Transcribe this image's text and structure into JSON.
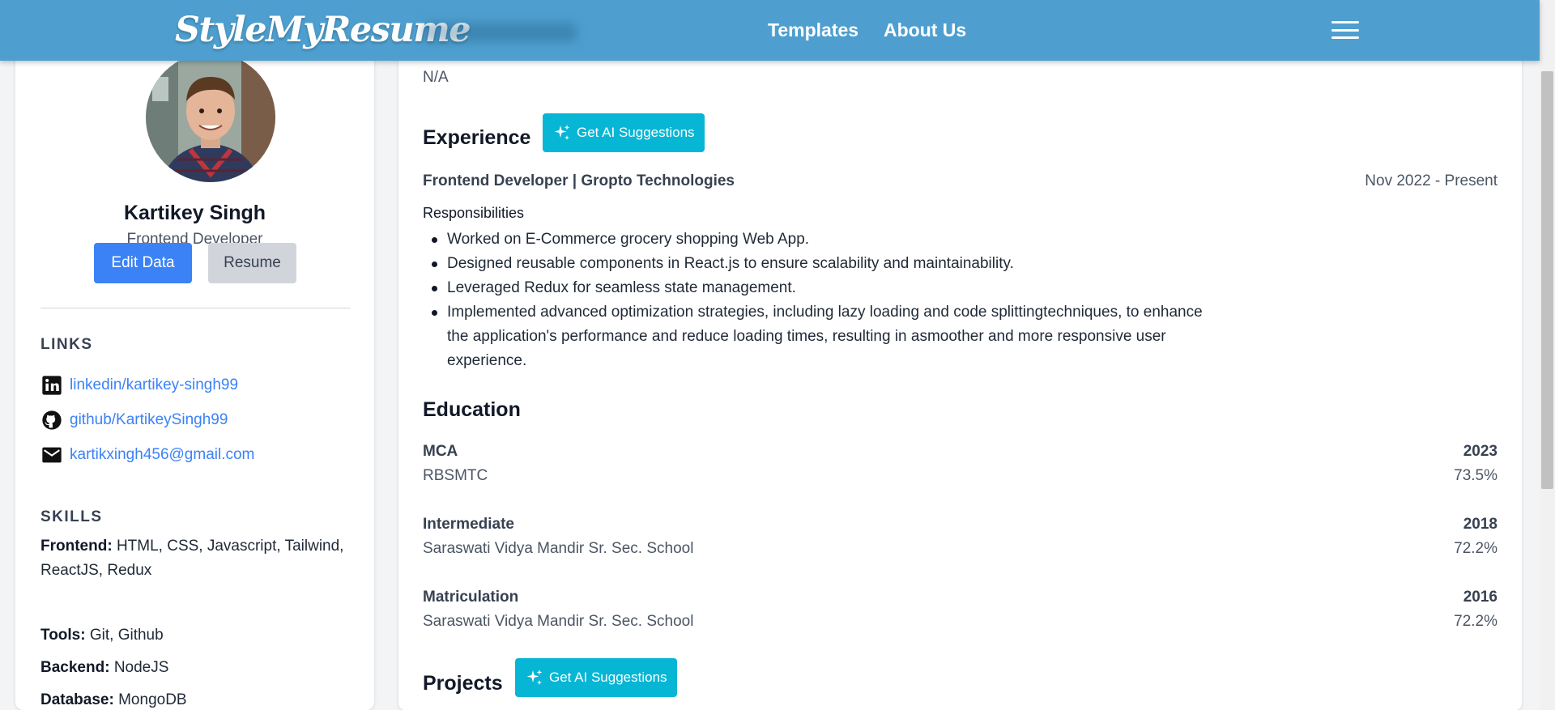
{
  "header": {
    "logo": "StyleMyResume",
    "nav": [
      "Templates",
      "About Us"
    ]
  },
  "profile": {
    "name": "Kartikey Singh",
    "role": "Frontend Developer",
    "edit_label": "Edit Data",
    "resume_label": "Resume"
  },
  "links": {
    "title": "LINKS",
    "items": [
      {
        "icon": "linkedin-icon",
        "text": "linkedin/kartikey-singh99"
      },
      {
        "icon": "github-icon",
        "text": "github/KartikeySingh99"
      },
      {
        "icon": "mail-icon",
        "text": "kartikxingh456@gmail.com"
      }
    ]
  },
  "skills": {
    "title": "SKILLS",
    "items": [
      {
        "label": "Frontend:",
        "value": "HTML, CSS, Javascript, Tailwind, ReactJS, Redux"
      },
      {
        "label": "Tools:",
        "value": "Git, Github"
      },
      {
        "label": "Backend:",
        "value": "NodeJS"
      },
      {
        "label": "Database:",
        "value": "MongoDB"
      }
    ]
  },
  "main": {
    "summary_value": "N/A",
    "ai_label": "Get AI Suggestions",
    "experience": {
      "title": "Experience",
      "job_title": "Frontend Developer | Gropto Technologies",
      "date": "Nov 2022 - Present",
      "resp_title": "Responsibilities",
      "items": [
        "Worked on E-Commerce grocery shopping Web App.",
        "Designed reusable components in React.js to ensure scalability and maintainability.",
        "Leveraged Redux for seamless state management.",
        "Implemented advanced optimization strategies, including lazy loading and code splittingtechniques, to enhance the application's performance and reduce loading times, resulting in asmoother and more responsive user experience."
      ]
    },
    "education": {
      "title": "Education",
      "items": [
        {
          "degree": "MCA",
          "institute": "RBSMTC",
          "year": "2023",
          "score": "73.5%"
        },
        {
          "degree": "Intermediate",
          "institute": "Saraswati Vidya Mandir Sr. Sec. School",
          "year": "2018",
          "score": "72.2%"
        },
        {
          "degree": "Matriculation",
          "institute": "Saraswati Vidya Mandir Sr. Sec. School",
          "year": "2016",
          "score": "72.2%"
        }
      ]
    },
    "projects": {
      "title": "Projects"
    }
  },
  "colors": {
    "header": "#4e9fcf",
    "primary": "#3b82f6",
    "ai_button": "#06b6d4",
    "link": "#3b82f6"
  }
}
